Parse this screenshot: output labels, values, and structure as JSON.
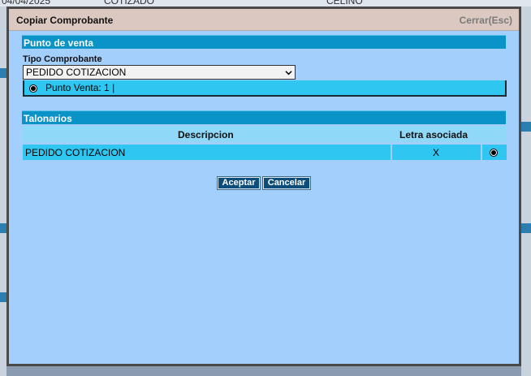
{
  "background": {
    "date": "04/04/2025",
    "status": "COTIZADO",
    "client": "CELINO"
  },
  "dialog": {
    "title": "Copiar Comprobante",
    "close_label": "Cerrar(Esc)"
  },
  "punto_venta_section": {
    "title": "Punto de venta",
    "tipo_label": "Tipo Comprobante",
    "tipo_selected": "PEDIDO COTIZACION",
    "punto_venta_option": "Punto Venta: 1 |"
  },
  "talonarios_section": {
    "title": "Talonarios",
    "columns": [
      "Descripcion",
      "Letra asociada"
    ],
    "rows": [
      {
        "descripcion": "PEDIDO COTIZACION",
        "letra": "X"
      }
    ]
  },
  "buttons": {
    "accept": "Aceptar",
    "cancel": "Cancelar"
  },
  "colors": {
    "section_bar": "#0a93c7",
    "row_highlight": "#2fc6f2",
    "dialog_bg": "#a3cffd",
    "button_bg": "#0d4d7a"
  }
}
